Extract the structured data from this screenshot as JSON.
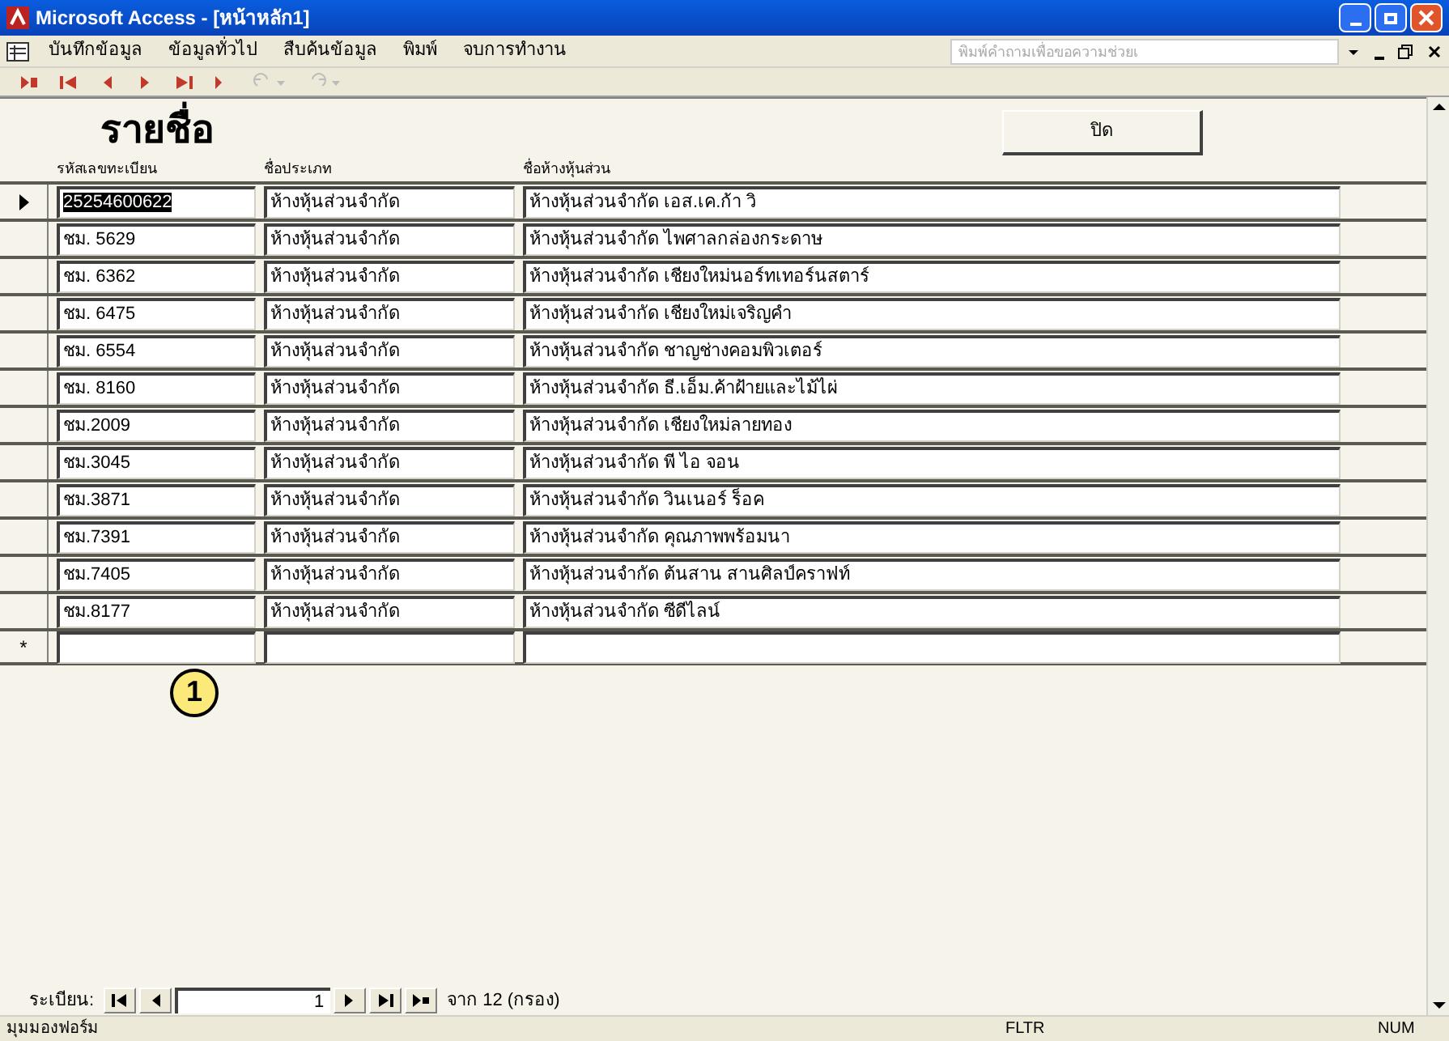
{
  "window": {
    "title": "Microsoft Access - [หน้าหลัก1]"
  },
  "menu": [
    "บันทึกข้อมูล",
    "ข้อมูลทั่วไป",
    "สืบค้นข้อมูล",
    "พิมพ์",
    "จบการทำงาน"
  ],
  "help_box": {
    "placeholder": "พิมพ์คำถามเพื่อขอความช่วยเ"
  },
  "form": {
    "title": "รายชื่อ",
    "close_button": "ปิด",
    "columns": [
      "รหัสเลขทะเบียน",
      "ชื่อประเภท",
      "ชื่อห้างหุ้นส่วน"
    ],
    "rows": [
      {
        "id": "25254600622",
        "type": "ห้างหุ้นส่วนจำกัด",
        "name": "ห้างหุ้นส่วนจำกัด เอส.เค.ก้า วิ",
        "selected": true
      },
      {
        "id": "ชม. 5629",
        "type": "ห้างหุ้นส่วนจำกัด",
        "name": "ห้างหุ้นส่วนจำกัด ไพศาลกล่องกระดาษ",
        "selected": false
      },
      {
        "id": "ชม. 6362",
        "type": "ห้างหุ้นส่วนจำกัด",
        "name": "ห้างหุ้นส่วนจำกัด เชียงใหม่นอร์ทเทอร์นสตาร์",
        "selected": false
      },
      {
        "id": "ชม. 6475",
        "type": "ห้างหุ้นส่วนจำกัด",
        "name": "ห้างหุ้นส่วนจำกัด เชียงใหม่เจริญคำ",
        "selected": false
      },
      {
        "id": "ชม. 6554",
        "type": "ห้างหุ้นส่วนจำกัด",
        "name": "ห้างหุ้นส่วนจำกัด ชาญช่างคอมพิวเตอร์",
        "selected": false
      },
      {
        "id": "ชม. 8160",
        "type": "ห้างหุ้นส่วนจำกัด",
        "name": "ห้างหุ้นส่วนจำกัด ธี.เอ็ม.ค้าฝ้ายและไม้ไผ่",
        "selected": false
      },
      {
        "id": "ชม.2009",
        "type": "ห้างหุ้นส่วนจำกัด",
        "name": "ห้างหุ้นส่วนจำกัด เชียงใหม่ลายทอง",
        "selected": false
      },
      {
        "id": "ชม.3045",
        "type": "ห้างหุ้นส่วนจำกัด",
        "name": "ห้างหุ้นส่วนจำกัด พี ไอ จอน",
        "selected": false
      },
      {
        "id": "ชม.3871",
        "type": "ห้างหุ้นส่วนจำกัด",
        "name": "ห้างหุ้นส่วนจำกัด วินเนอร์ ร็อค",
        "selected": false
      },
      {
        "id": "ชม.7391",
        "type": "ห้างหุ้นส่วนจำกัด",
        "name": "ห้างหุ้นส่วนจำกัด คุณภาพพร้อมนา",
        "selected": false
      },
      {
        "id": "ชม.7405",
        "type": "ห้างหุ้นส่วนจำกัด",
        "name": "ห้างหุ้นส่วนจำกัด ต้นสาน สานศิลป์คราฟท์",
        "selected": false
      },
      {
        "id": "ชม.8177",
        "type": "ห้างหุ้นส่วนจำกัด",
        "name": "ห้างหุ้นส่วนจำกัด ซีดีไลน์",
        "selected": false
      }
    ],
    "new_row_marker": "*",
    "callout": "1"
  },
  "navigator": {
    "label": "ระเบียน:",
    "record": "1",
    "total": "จาก 12 (กรอง)"
  },
  "status_bar": {
    "mode": "มุมมองฟอร์ม",
    "indicators": [
      "FLTR",
      "NUM"
    ]
  }
}
